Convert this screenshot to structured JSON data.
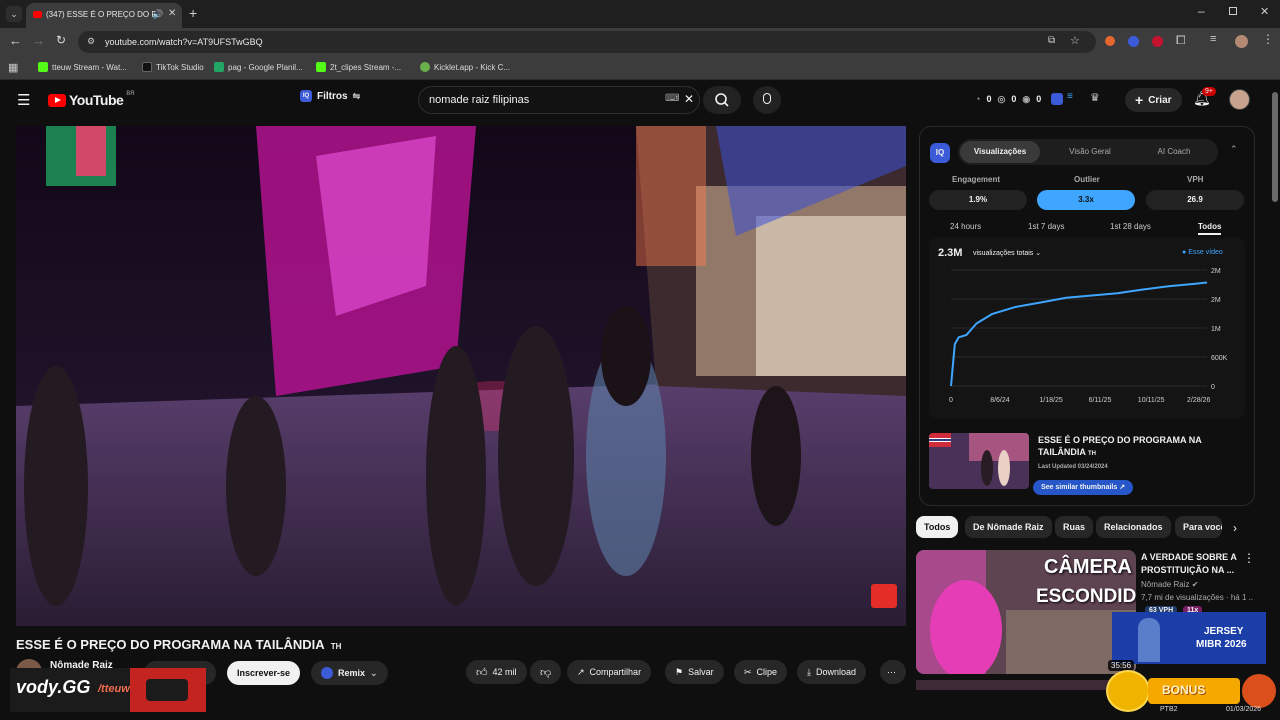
{
  "browser": {
    "tab_title": "(347) ESSE É O PREÇO DO P",
    "url": "youtube.com/watch?v=AT9UFSTwGBQ",
    "bookmarks": [
      "tteuw Stream - Wat...",
      "TikTok Studio",
      "pag - Google Planil...",
      "2t_clipes Stream -...",
      "Kicklet.app - Kick C..."
    ]
  },
  "header": {
    "logo": "YouTube",
    "region": "BR",
    "filters_label": "Filtros",
    "search_value": "nomade raiz filipinas",
    "stats": [
      "0",
      "0",
      "0"
    ],
    "create_label": "Criar",
    "notif_badge": "9+"
  },
  "video": {
    "title": "ESSE É O PREÇO DO PROGRAMA NA TAILÂNDIA",
    "title_suffix": "TH",
    "channel": "Nômade Raiz",
    "subscribe_label": "Inscrever-se",
    "remix_label": "Remix",
    "likes": "42 mil",
    "share_label": "Compartilhar",
    "save_label": "Salvar",
    "clip_label": "Clipe",
    "download_label": "Download"
  },
  "panel": {
    "tabs": [
      "Visualizações",
      "Visão Geral",
      "AI Coach"
    ],
    "metrics": [
      {
        "label": "Engagement",
        "value": "1.9%"
      },
      {
        "label": "Outlier",
        "value": "3.3x"
      },
      {
        "label": "VPH",
        "value": "26.9"
      }
    ],
    "ranges": [
      "24 hours",
      "1st 7 days",
      "1st 28 days",
      "Todos"
    ],
    "total_views": "2.3M",
    "views_selector": "visualizações totais",
    "legend": "Esse vídeo",
    "thumb_title": "ESSE É O PREÇO DO PROGRAMA NA TAILÂNDIA",
    "thumb_suffix": "TH",
    "last_updated": "Last Updated 03/24/2024",
    "similar_label": "See similar thumbnails"
  },
  "chart_data": {
    "type": "line",
    "x_ticks": [
      "0",
      "8/6/24",
      "1/18/25",
      "6/11/25",
      "10/11/25",
      "2/28/26"
    ],
    "y_ticks": [
      "2M",
      "2M",
      "1M",
      "600K",
      "0"
    ],
    "series": [
      {
        "name": "Esse vídeo",
        "x": [
          0,
          0.015,
          0.03,
          0.06,
          0.1,
          0.16,
          0.25,
          0.35,
          0.45,
          0.55,
          0.65,
          0.75,
          0.85,
          0.95,
          1.0
        ],
        "y": [
          0,
          900000,
          1050000,
          1100000,
          1350000,
          1550000,
          1700000,
          1800000,
          1900000,
          1950000,
          2000000,
          2080000,
          2150000,
          2200000,
          2230000
        ]
      }
    ],
    "ylim": [
      0,
      2500000
    ],
    "color": "#3ea6ff"
  },
  "recommendations": {
    "chips": [
      "Todos",
      "De Nômade Raiz",
      "Ruas",
      "Relacionados",
      "Para você"
    ],
    "items": [
      {
        "thumb_text_1": "CÂMERA",
        "thumb_text_2": "ESCONDIDA",
        "title": "A VERDADE SOBRE A PROSTITUIÇÃO NA ...",
        "channel": "Nômade Raiz",
        "meta": "7,7 mi de visualizações · há 1 ...",
        "vph": "63 VPH",
        "outlier": "11x",
        "duration": "35:56"
      }
    ]
  },
  "overlay": {
    "brand": "vody.GG",
    "handle": "/tteuw",
    "jersey_line1": "JERSEY",
    "jersey_line2": "MIBR 2026",
    "bonus": "BONUS"
  },
  "taskbar": {
    "lang": "PTB2",
    "date": "01/03/2026"
  }
}
